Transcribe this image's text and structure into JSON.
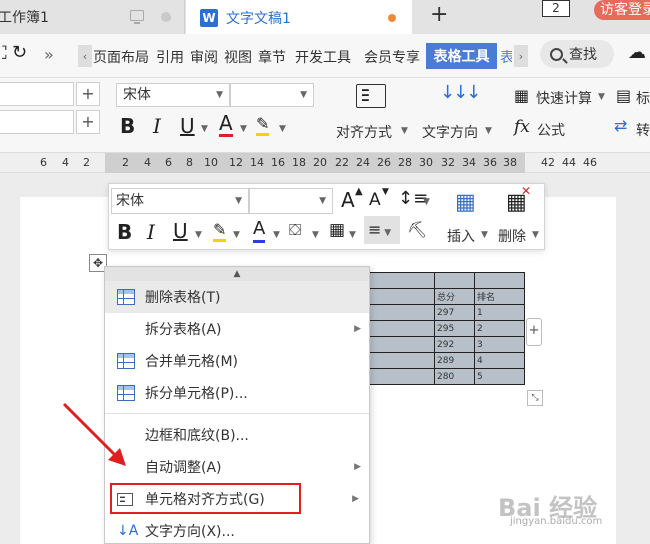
{
  "tabs": {
    "tab1_label": "工作簿1",
    "tab2_logo": "W",
    "tab2_label": "文字文稿1",
    "new_tab": "+",
    "window_count": "2",
    "visitor_login": "访客登录"
  },
  "menu": {
    "items": [
      "页面布局",
      "引用",
      "审阅",
      "视图",
      "章节",
      "开发工具",
      "会员专享"
    ],
    "active": "表格工具",
    "overflow_hint": "表",
    "search_label": "查找",
    "double_chevron": "»"
  },
  "toolbar": {
    "font_name": "宋体",
    "plus": "+",
    "align_label": "对齐方式",
    "direction_label": "文字方向",
    "quick_calc_label": "快速计算",
    "formula_label": "公式",
    "formula_icon": "fx",
    "right_cut1": "标",
    "right_cut2": "转",
    "bold": "B",
    "italic": "I",
    "underline": "U",
    "font_color": "A"
  },
  "ruler": {
    "left_numbers": [
      "6",
      "4",
      "2"
    ],
    "right_numbers": [
      "2",
      "4",
      "6",
      "8",
      "10",
      "12",
      "14",
      "16",
      "18",
      "20",
      "22",
      "24",
      "26",
      "28",
      "30",
      "32",
      "34",
      "36",
      "38"
    ],
    "far_numbers": [
      "42",
      "44",
      "46"
    ]
  },
  "float_toolbar": {
    "font_name": "宋体",
    "grow_font": "A",
    "shrink_font": "A",
    "bold": "B",
    "italic": "I",
    "underline": "U",
    "font_color": "A",
    "insert_label": "插入",
    "delete_label": "删除"
  },
  "table": {
    "headers": [
      "总分",
      "排名"
    ],
    "rows": [
      [
        "297",
        "1"
      ],
      [
        "295",
        "2"
      ],
      [
        "292",
        "3"
      ],
      [
        "289",
        "4"
      ],
      [
        "280",
        "5"
      ]
    ]
  },
  "context_menu": {
    "items": [
      {
        "label": "删除表格(T)",
        "icon": "delete-table-icon"
      },
      {
        "label": "拆分表格(A)",
        "icon": ""
      },
      {
        "label": "合并单元格(M)",
        "icon": "merge-cells-icon"
      },
      {
        "label": "拆分单元格(P)...",
        "icon": "split-cells-icon"
      },
      {
        "label": "边框和底纹(B)...",
        "icon": ""
      },
      {
        "label": "自动调整(A)",
        "icon": ""
      },
      {
        "label": "单元格对齐方式(G)",
        "icon": "cell-align-icon"
      },
      {
        "label": "文字方向(X)...",
        "icon": "text-direction-icon"
      }
    ]
  },
  "watermark": {
    "text": "Bai 经验",
    "url": "jingyan.baidu.com"
  },
  "colors": {
    "accent": "#4a7bd6",
    "highlight_box": "#e02020",
    "table_fill": "#b7c0c9"
  }
}
